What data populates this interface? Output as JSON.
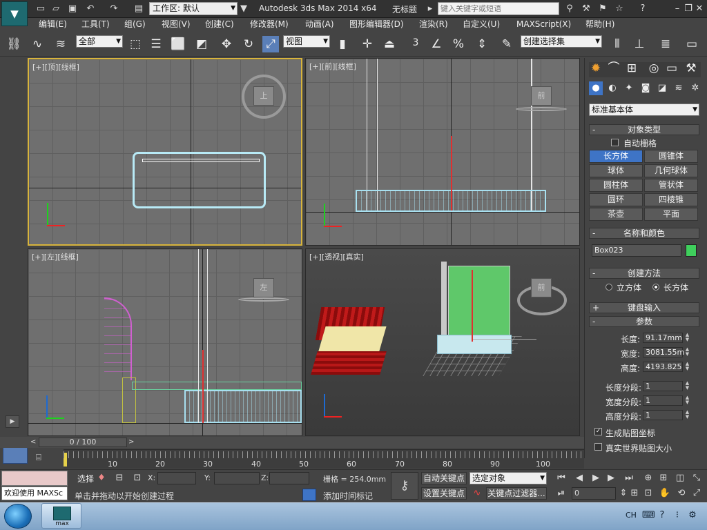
{
  "title": {
    "workspace_label": "工作区: 默认",
    "app_title": "Autodesk 3ds Max  2014 x64",
    "doc_title": "无标题",
    "search_placeholder": "键入关键字或短语"
  },
  "menu": [
    "编辑(E)",
    "工具(T)",
    "组(G)",
    "视图(V)",
    "创建(C)",
    "修改器(M)",
    "动画(A)",
    "图形编辑器(D)",
    "渲染(R)",
    "自定义(U)",
    "MAXScript(X)",
    "帮助(H)"
  ],
  "toolbar": {
    "filter_value": "全部",
    "ref_coord_value": "视图",
    "snap_number": "3",
    "named_sel_value": "创建选择集"
  },
  "viewports": {
    "top_label": "[+][顶][线框]",
    "front_label": "[+][前][线框]",
    "left_label": "[+][左][线框]",
    "persp_label": "[+][透视][真实]",
    "top_cube": "上",
    "front_cube": "前",
    "left_cube": "左",
    "persp_cube": "前"
  },
  "command_panel": {
    "category_value": "标准基本体",
    "object_type_title": "对象类型",
    "autogrid_label": "自动栅格",
    "objects": [
      "长方体",
      "圆锥体",
      "球体",
      "几何球体",
      "圆柱体",
      "管状体",
      "圆环",
      "四棱锥",
      "茶壶",
      "平面"
    ],
    "selected_object": "长方体",
    "name_color_title": "名称和颜色",
    "object_name": "Box023",
    "object_color": "#3fcf5c",
    "creation_method_title": "创建方法",
    "method_cube": "立方体",
    "method_box": "长方体",
    "keyboard_entry_title": "键盘输入",
    "params_title": "参数",
    "length_label": "长度:",
    "length_value": "91.17mm",
    "width_label": "宽度:",
    "width_value": "3081.55m",
    "height_label": "高度:",
    "height_value": "4193.825",
    "length_seg_label": "长度分段:",
    "length_seg_value": "1",
    "width_seg_label": "宽度分段:",
    "width_seg_value": "1",
    "height_seg_label": "高度分段:",
    "height_seg_value": "1",
    "gen_map_label": "生成贴图坐标",
    "real_world_label": "真实世界贴图大小"
  },
  "timeline": {
    "frame_display": "0 / 100",
    "ticks": [
      "10",
      "20",
      "30",
      "40",
      "50",
      "60",
      "70",
      "80",
      "90",
      "100"
    ]
  },
  "status": {
    "welcome_text": "欢迎使用 MAXSc",
    "select_label": "选择",
    "x_label": "X:",
    "y_label": "Y:",
    "z_label": "Z:",
    "grid_label": "栅格 = 254.0mm",
    "auto_key_label": "自动关键点",
    "set_key_label": "设置关键点",
    "selected_value": "选定对象",
    "key_filter_label": "关键点过滤器...",
    "prompt_text": "单击并拖动以开始创建过程",
    "add_time_tag": "添加时间标记",
    "frame_input": "0"
  },
  "taskbar": {
    "max_label": "max",
    "lang": "CH"
  }
}
